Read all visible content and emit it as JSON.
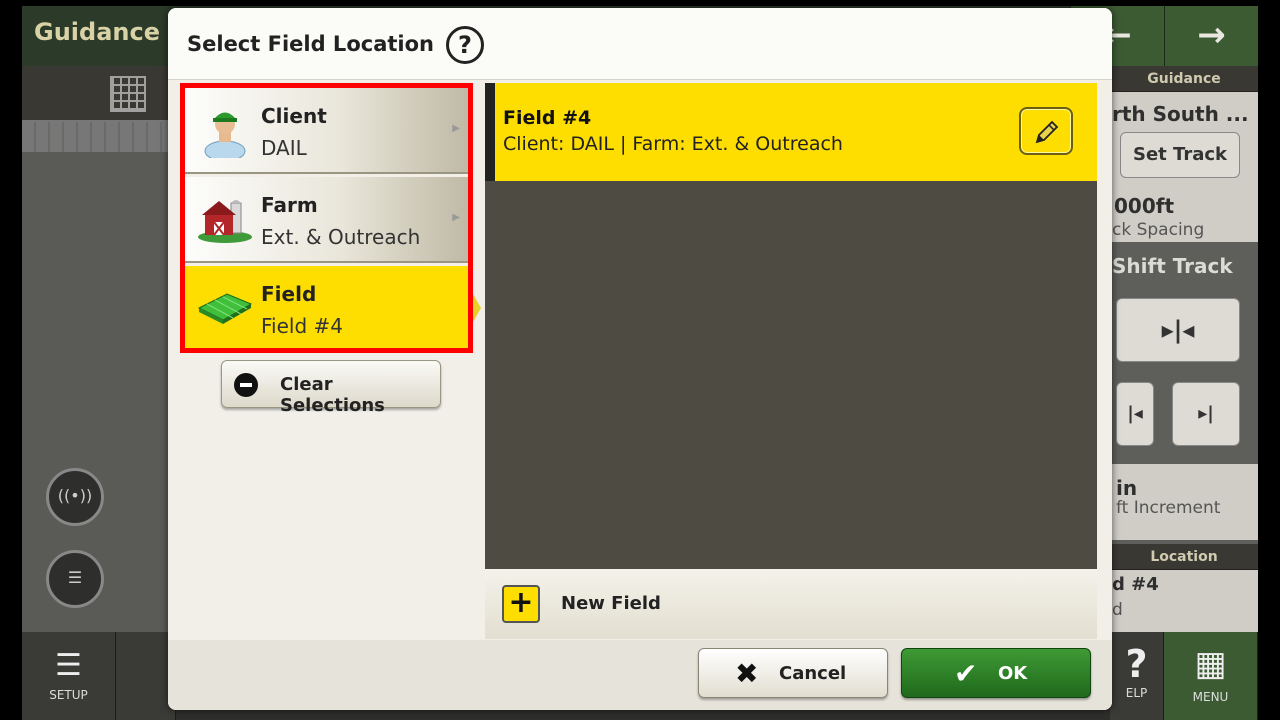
{
  "background": {
    "app_title": "Guidance",
    "nav_forward_icon": "arrow-right",
    "guidance_panel": {
      "header": "Guidance",
      "track_name": "rth South ...",
      "set_track_label": "Set Track",
      "spacing_value": "000ft",
      "spacing_label": "ck Spacing",
      "shift_track_label": "Shift Track",
      "shift_value": "in",
      "shift_label": "ft Increment",
      "location_header": "Location",
      "location_value": "d #4",
      "location_sub": "d"
    },
    "bottom": {
      "setup_label": "SETUP",
      "help_label": "ELP",
      "menu_label": "MENU"
    }
  },
  "dialog": {
    "title": "Select Field Location",
    "help_symbol": "?",
    "selections": [
      {
        "title": "Client",
        "value": "DAIL",
        "icon": "person-icon"
      },
      {
        "title": "Farm",
        "value": "Ext. & Outreach",
        "icon": "barn-icon"
      },
      {
        "title": "Field",
        "value": "Field #4",
        "icon": "field-icon"
      }
    ],
    "clear_label": "Clear Selections",
    "field_list": [
      {
        "name": "Field #4",
        "detail": "Client: DAIL | Farm: Ext. & Outreach"
      }
    ],
    "new_field_label": "New Field",
    "cancel_label": "Cancel",
    "ok_label": "OK"
  },
  "colors": {
    "selection_yellow": "#fede00",
    "ok_green": "#2f8a2a",
    "highlight_red": "#ff0000"
  }
}
